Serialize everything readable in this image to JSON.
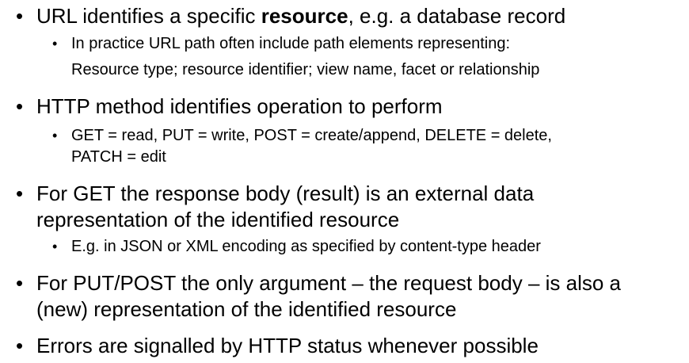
{
  "bullets": [
    {
      "text_before": "URL identifies a specific ",
      "text_bold": "resource",
      "text_after": ", e.g. a database record",
      "sub": [
        {
          "lines": [
            "In practice URL path often include path elements representing:",
            "Resource type; resource identifier; view name, facet or relationship"
          ]
        }
      ]
    },
    {
      "text": "HTTP method identifies operation to perform",
      "sub": [
        {
          "lines": [
            "GET = read, PUT = write, POST = create/append, DELETE = delete,",
            "PATCH = edit"
          ]
        }
      ]
    },
    {
      "lines": [
        "For GET the response body (result) is an external data",
        "representation of the identified resource"
      ],
      "sub": [
        {
          "lines": [
            "E.g. in JSON or XML encoding as specified by content-type header"
          ]
        }
      ]
    },
    {
      "lines": [
        "For PUT/POST the only argument – the request body – is also a",
        "(new) representation of the identified resource"
      ]
    },
    {
      "text": "Errors are signalled by HTTP status whenever possible"
    }
  ],
  "bullet_glyph": "•"
}
